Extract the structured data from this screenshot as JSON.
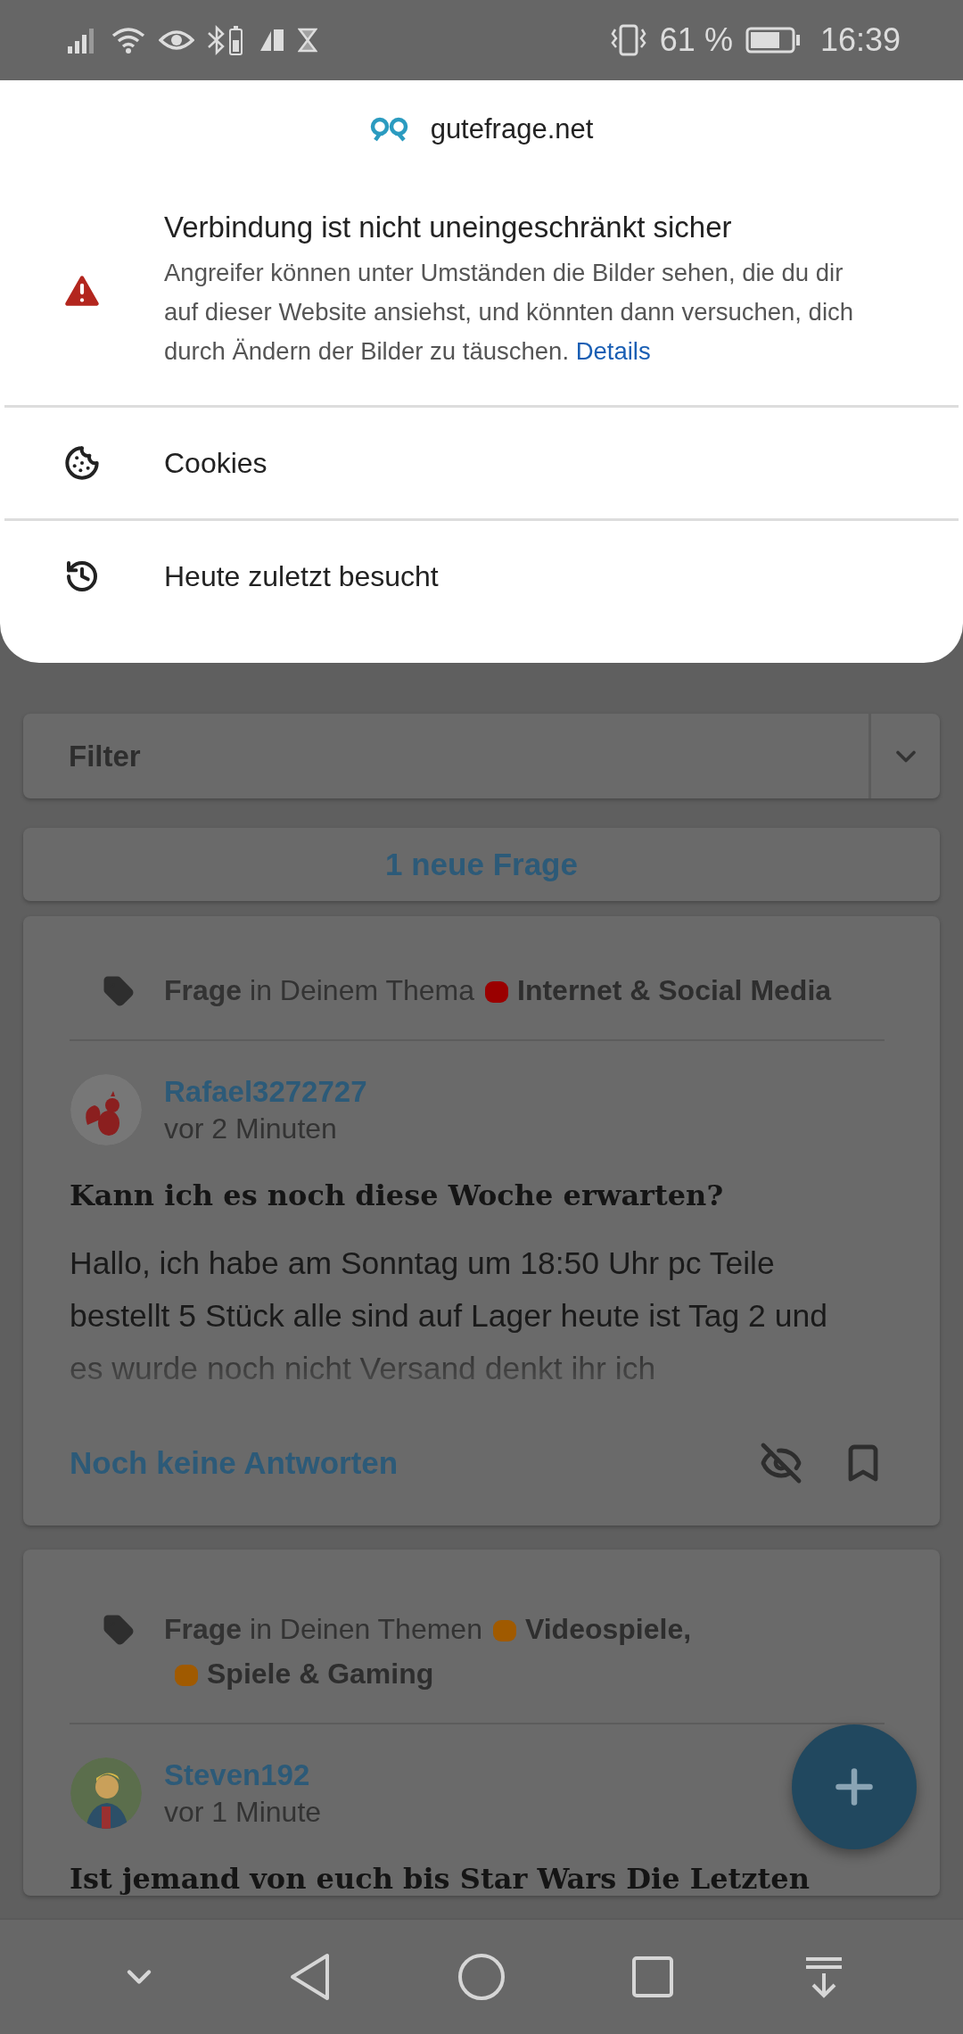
{
  "status_bar": {
    "battery": "61 %",
    "time": "16:39"
  },
  "site_info": {
    "site": "gutefrage.net",
    "security": {
      "title": "Verbindung ist nicht uneingeschränkt sicher",
      "description": "Angreifer können unter Umständen die Bilder sehen, die du dir auf dieser Website ansiehst, und könnten dann versuchen, dich durch Ändern der Bilder zu täuschen.",
      "link": "Details"
    },
    "items": [
      {
        "kind": "cookies",
        "label": "Cookies"
      },
      {
        "kind": "history",
        "label": "Heute zuletzt besucht"
      }
    ]
  },
  "feed": {
    "filter": {
      "label": "Filter"
    },
    "new_questions": "1 neue Frage",
    "questions": [
      {
        "meta": "**Frage** in Deinem Thema",
        "topics": [
          {
            "name": "Internet & Social Media",
            "color": "#9a0000"
          }
        ],
        "author": "Rafael3272727",
        "avatar": {
          "kind": "picture"
        },
        "time": "vor 2 Minuten",
        "title": "Kann ich es noch diese Woche erwarten?",
        "excerpt": "Hallo, ich habe am Sonntag um 18:50 Uhr pc Teile bestellt 5 Stück alle sind auf Lager heute ist Tag 2 und es wurde noch nicht Versand denkt ihr ich",
        "answers": "Noch keine Antworten"
      },
      {
        "meta": "**Frage** in Deinen Themen",
        "topics": [
          {
            "name": "Videospiele,",
            "color": "#a05a00"
          },
          {
            "name": "Spiele & Gaming",
            "color": "#a05a00"
          }
        ],
        "author": "Steven192",
        "avatar": {
          "kind": "picture"
        },
        "time": "vor 1 Minute",
        "title": "Ist jemand von euch bis Star Wars Die Letzten"
      }
    ]
  }
}
